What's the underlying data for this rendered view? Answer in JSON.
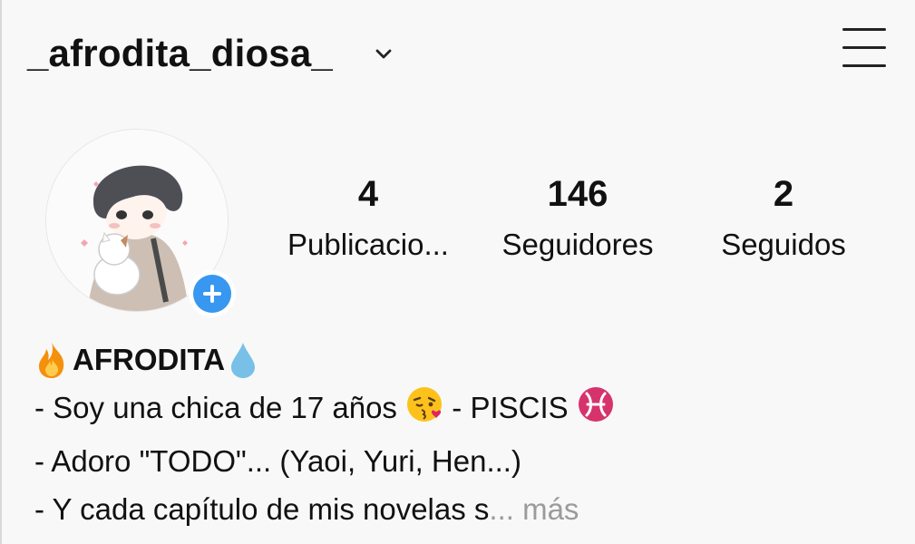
{
  "header": {
    "username": "_afrodita_diosa_",
    "dropdown_icon": "chevron-down-icon",
    "menu_icon": "hamburger-menu-icon"
  },
  "stats": {
    "posts": {
      "value": "4",
      "label": "Publicacio..."
    },
    "followers": {
      "value": "146",
      "label": "Seguidores"
    },
    "following": {
      "value": "2",
      "label": "Seguidos"
    }
  },
  "bio": {
    "name": "AFRODITA",
    "line1_part1": "- Soy una chica de 17 años",
    "line1_part2": "- PISCIS",
    "line2": "- Adoro \"TODO\"... (Yaoi, Yuri, Hen...)",
    "line3": "- Y cada capítulo de mis novelas s",
    "ellipsis": "...",
    "more": " más"
  },
  "colors": {
    "accent_blue": "#3897f0",
    "background": "#f8f8f8",
    "muted": "#9b9b9b"
  }
}
